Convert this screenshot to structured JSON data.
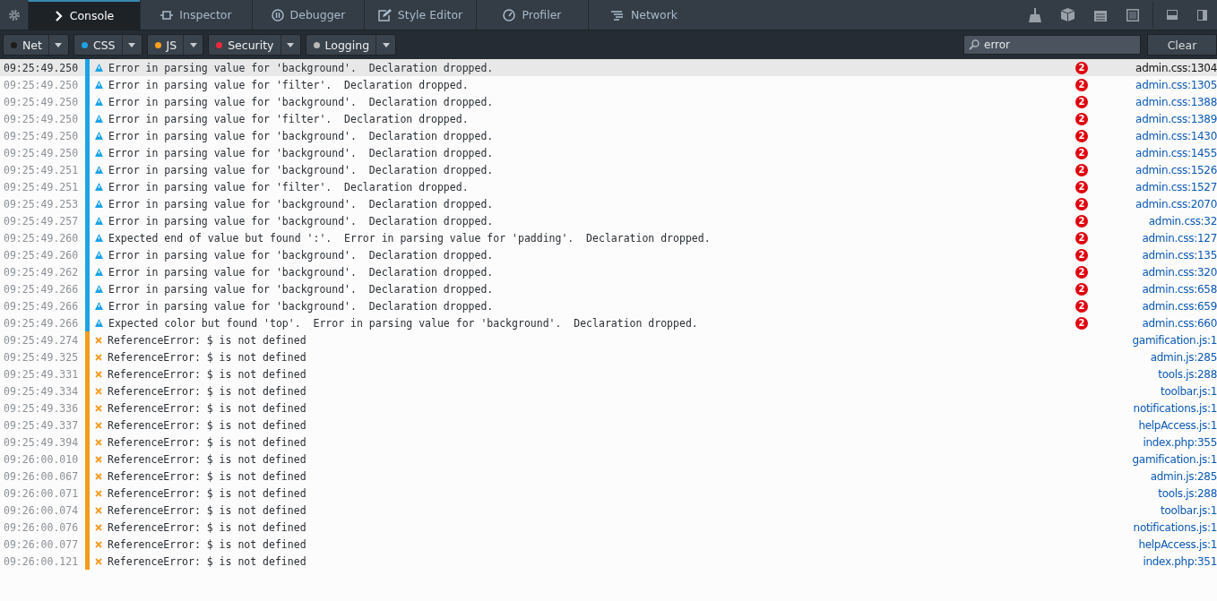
{
  "tabs": [
    {
      "label": "Console",
      "kind": "console",
      "selected": true
    },
    {
      "label": "Inspector",
      "kind": "inspector",
      "selected": false
    },
    {
      "label": "Debugger",
      "kind": "debugger",
      "selected": false
    },
    {
      "label": "Style Editor",
      "kind": "style-editor",
      "selected": false
    },
    {
      "label": "Profiler",
      "kind": "profiler",
      "selected": false
    },
    {
      "label": "Network",
      "kind": "network",
      "selected": false
    }
  ],
  "filters": [
    {
      "label": "Net",
      "color": "#1c1c1c"
    },
    {
      "label": "CSS",
      "color": "#1ba3e5"
    },
    {
      "label": "JS",
      "color": "#f5a01e"
    },
    {
      "label": "Security",
      "color": "#ed2a3a"
    },
    {
      "label": "Logging",
      "color": "#b8b8b8"
    }
  ],
  "search": {
    "value": "error"
  },
  "clear_button": "Clear",
  "messages": [
    {
      "time": "09:25:49.250",
      "kind": "css-warning",
      "text": "Error in parsing value for 'background'.  Declaration dropped.",
      "repeat": "2",
      "location": "admin.css:1304",
      "selected": true
    },
    {
      "time": "09:25:49.250",
      "kind": "css-warning",
      "text": "Error in parsing value for 'filter'.  Declaration dropped.",
      "repeat": "2",
      "location": "admin.css:1305",
      "selected": false
    },
    {
      "time": "09:25:49.250",
      "kind": "css-warning",
      "text": "Error in parsing value for 'background'.  Declaration dropped.",
      "repeat": "2",
      "location": "admin.css:1388",
      "selected": false
    },
    {
      "time": "09:25:49.250",
      "kind": "css-warning",
      "text": "Error in parsing value for 'filter'.  Declaration dropped.",
      "repeat": "2",
      "location": "admin.css:1389",
      "selected": false
    },
    {
      "time": "09:25:49.250",
      "kind": "css-warning",
      "text": "Error in parsing value for 'background'.  Declaration dropped.",
      "repeat": "2",
      "location": "admin.css:1430",
      "selected": false
    },
    {
      "time": "09:25:49.250",
      "kind": "css-warning",
      "text": "Error in parsing value for 'background'.  Declaration dropped.",
      "repeat": "2",
      "location": "admin.css:1455",
      "selected": false
    },
    {
      "time": "09:25:49.251",
      "kind": "css-warning",
      "text": "Error in parsing value for 'background'.  Declaration dropped.",
      "repeat": "2",
      "location": "admin.css:1526",
      "selected": false
    },
    {
      "time": "09:25:49.251",
      "kind": "css-warning",
      "text": "Error in parsing value for 'filter'.  Declaration dropped.",
      "repeat": "2",
      "location": "admin.css:1527",
      "selected": false
    },
    {
      "time": "09:25:49.253",
      "kind": "css-warning",
      "text": "Error in parsing value for 'background'.  Declaration dropped.",
      "repeat": "2",
      "location": "admin.css:2070",
      "selected": false
    },
    {
      "time": "09:25:49.257",
      "kind": "css-warning",
      "text": "Error in parsing value for 'background'.  Declaration dropped.",
      "repeat": "2",
      "location": "admin.css:32",
      "selected": false
    },
    {
      "time": "09:25:49.260",
      "kind": "css-warning",
      "text": "Expected end of value but found ':'.  Error in parsing value for 'padding'.  Declaration dropped.",
      "repeat": "2",
      "location": "admin.css:127",
      "selected": false
    },
    {
      "time": "09:25:49.260",
      "kind": "css-warning",
      "text": "Error in parsing value for 'background'.  Declaration dropped.",
      "repeat": "2",
      "location": "admin.css:135",
      "selected": false
    },
    {
      "time": "09:25:49.262",
      "kind": "css-warning",
      "text": "Error in parsing value for 'background'.  Declaration dropped.",
      "repeat": "2",
      "location": "admin.css:320",
      "selected": false
    },
    {
      "time": "09:25:49.266",
      "kind": "css-warning",
      "text": "Error in parsing value for 'background'.  Declaration dropped.",
      "repeat": "2",
      "location": "admin.css:658",
      "selected": false
    },
    {
      "time": "09:25:49.266",
      "kind": "css-warning",
      "text": "Error in parsing value for 'background'.  Declaration dropped.",
      "repeat": "2",
      "location": "admin.css:659",
      "selected": false
    },
    {
      "time": "09:25:49.266",
      "kind": "css-warning",
      "text": "Expected color but found 'top'.  Error in parsing value for 'background'.  Declaration dropped.",
      "repeat": "2",
      "location": "admin.css:660",
      "selected": false
    },
    {
      "time": "09:25:49.274",
      "kind": "js-error",
      "text": "ReferenceError: $ is not defined",
      "location": "gamification.js:1",
      "selected": false
    },
    {
      "time": "09:25:49.325",
      "kind": "js-error",
      "text": "ReferenceError: $ is not defined",
      "location": "admin.js:285",
      "selected": false
    },
    {
      "time": "09:25:49.331",
      "kind": "js-error",
      "text": "ReferenceError: $ is not defined",
      "location": "tools.js:288",
      "selected": false
    },
    {
      "time": "09:25:49.334",
      "kind": "js-error",
      "text": "ReferenceError: $ is not defined",
      "location": "toolbar.js:1",
      "selected": false
    },
    {
      "time": "09:25:49.336",
      "kind": "js-error",
      "text": "ReferenceError: $ is not defined",
      "location": "notifications.js:1",
      "selected": false
    },
    {
      "time": "09:25:49.337",
      "kind": "js-error",
      "text": "ReferenceError: $ is not defined",
      "location": "helpAccess.js:1",
      "selected": false
    },
    {
      "time": "09:25:49.394",
      "kind": "js-error",
      "text": "ReferenceError: $ is not defined",
      "location": "index.php:355",
      "selected": false
    },
    {
      "time": "09:26:00.010",
      "kind": "js-error",
      "text": "ReferenceError: $ is not defined",
      "location": "gamification.js:1",
      "selected": false
    },
    {
      "time": "09:26:00.067",
      "kind": "js-error",
      "text": "ReferenceError: $ is not defined",
      "location": "admin.js:285",
      "selected": false
    },
    {
      "time": "09:26:00.071",
      "kind": "js-error",
      "text": "ReferenceError: $ is not defined",
      "location": "tools.js:288",
      "selected": false
    },
    {
      "time": "09:26:00.074",
      "kind": "js-error",
      "text": "ReferenceError: $ is not defined",
      "location": "toolbar.js:1",
      "selected": false
    },
    {
      "time": "09:26:00.076",
      "kind": "js-error",
      "text": "ReferenceError: $ is not defined",
      "location": "notifications.js:1",
      "selected": false
    },
    {
      "time": "09:26:00.077",
      "kind": "js-error",
      "text": "ReferenceError: $ is not defined",
      "location": "helpAccess.js:1",
      "selected": false
    },
    {
      "time": "09:26:00.121",
      "kind": "js-error",
      "text": "ReferenceError: $ is not defined",
      "location": "index.php:351",
      "selected": false
    }
  ]
}
